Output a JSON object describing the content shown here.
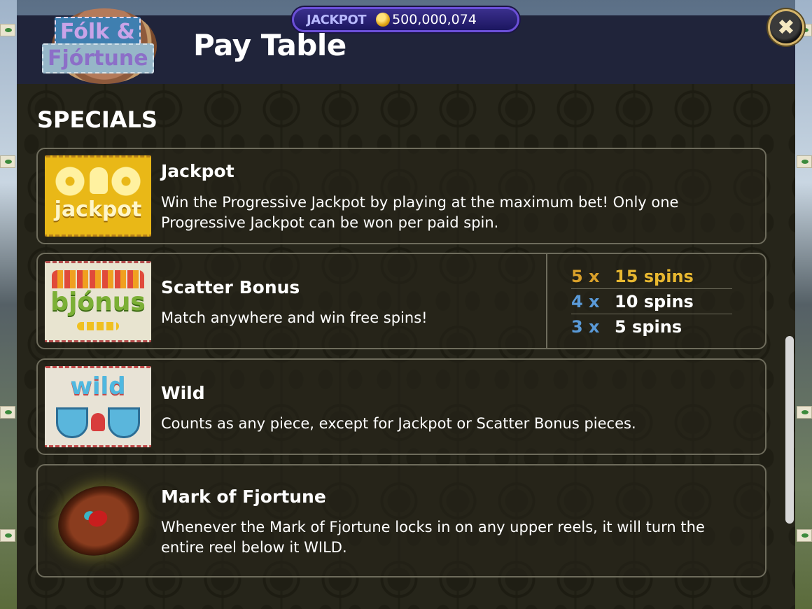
{
  "header": {
    "jackpot_label": "JACKPOT",
    "jackpot_value": "500,000,074",
    "logo_line1": "Fólk &",
    "logo_line2": "Fjórtune",
    "title": "Pay Table",
    "close_icon": "✖"
  },
  "section_title": "SPECIALS",
  "items": [
    {
      "symbol_text": "jackpot",
      "title": "Jackpot",
      "description": "Win the Progressive Jackpot by playing at the maximum bet! Only one Progressive Jackpot can be won per paid spin."
    },
    {
      "symbol_text": "bjónus",
      "title": "Scatter Bonus",
      "description": "Match anywhere and win free spins!",
      "spins": [
        {
          "multiplier": "5 x",
          "spins": "15 spins",
          "color": "#d9a02a",
          "count_color": "#e8b830"
        },
        {
          "multiplier": "4 x",
          "spins": "10 spins",
          "color": "#5a9ad8",
          "count_color": "#ffffff"
        },
        {
          "multiplier": "3 x",
          "spins": "5 spins",
          "color": "#5a9ad8",
          "count_color": "#ffffff"
        }
      ]
    },
    {
      "symbol_text": "wild",
      "title": "Wild",
      "description": "Counts as any piece, except for Jackpot or Scatter Bonus pieces."
    },
    {
      "title": "Mark of Fjortune",
      "description": "Whenever the Mark of Fjortune locks in on any upper reels, it will turn the entire reel below it WILD."
    }
  ]
}
